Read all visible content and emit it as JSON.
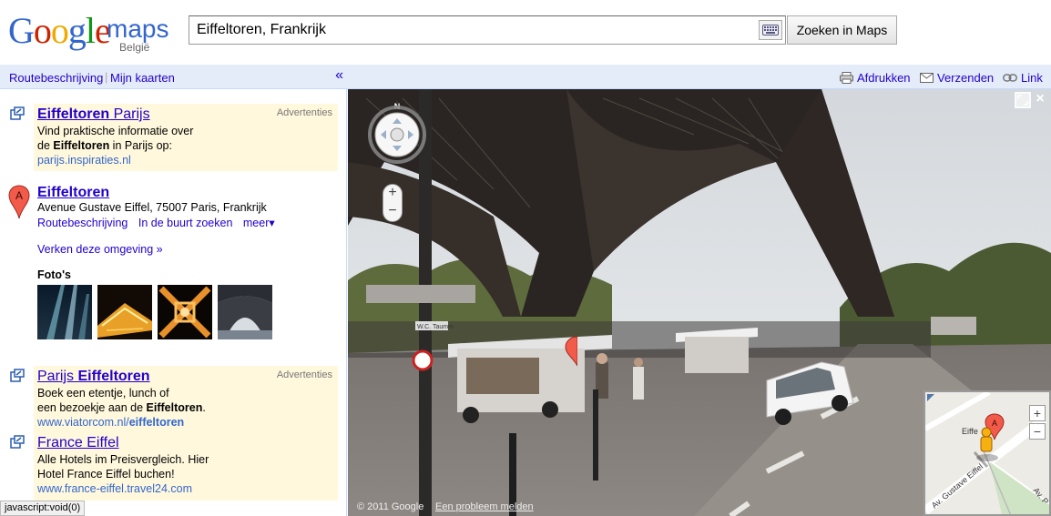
{
  "header": {
    "logo_google": "Google",
    "logo_maps": "maps",
    "logo_country": "België",
    "search_value": "Eiffeltoren, Frankrijk",
    "search_button": "Zoeken in Maps"
  },
  "left_toolbar": {
    "directions": "Routebeschrijving",
    "my_maps": "Mijn kaarten",
    "collapse": "«"
  },
  "right_toolbar": {
    "print": "Afdrukken",
    "send": "Verzenden",
    "link": "Link"
  },
  "ad1": {
    "label": "Advertenties",
    "title_bold": "Eiffeltoren",
    "title_rest": " Parijs",
    "line1": "Vind praktische informatie over",
    "line2_pre": "de ",
    "line2_bold": "Eiffeltoren",
    "line2_post": " in Parijs op:",
    "url": "parijs.inspiraties.nl"
  },
  "result": {
    "marker": "A",
    "title": "Eiffeltoren",
    "address": "Avenue Gustave Eiffel, 75007 Paris, Frankrijk",
    "link_directions": "Routebeschrijving",
    "link_nearby": "In de buurt zoeken",
    "link_more": "meer▾",
    "explore": "Verken deze omgeving »",
    "photos_title": "Foto's"
  },
  "ad2": {
    "label": "Advertenties",
    "title_pre": "Parijs ",
    "title_bold": "Eiffeltoren",
    "line1": "Boek een etentje, lunch of",
    "line2_pre": "een bezoekje aan de ",
    "line2_bold": "Eiffeltoren",
    "line2_post": ".",
    "url_pre": "www.viatorcom.nl/",
    "url_bold": "eiffeltoren"
  },
  "ad3": {
    "title": "France Eiffel",
    "line1": "Alle Hotels im Preisvergleich. Hier",
    "line2": "Hotel France Eiffel buchen!",
    "url": "www.france-eiffel.travel24.com"
  },
  "status_bar": "javascript:void(0)",
  "streetview": {
    "compass_n": "N",
    "zoom_in": "+",
    "zoom_out": "−",
    "close": "×",
    "copyright": "© 2011 Google",
    "report": "Een probleem melden",
    "street_sign": "W.C. Taumm"
  },
  "minimap": {
    "marker": "A",
    "label": "Eiffe",
    "street1": "Av. Gustave Eiffel",
    "street2": "Av. P",
    "zoom_in": "+",
    "zoom_out": "−"
  },
  "colors": {
    "link": "#2200cc",
    "toolbar_bg": "#e5ecf9",
    "ad_bg": "#fff8dd",
    "url_green": "#3366cc"
  }
}
